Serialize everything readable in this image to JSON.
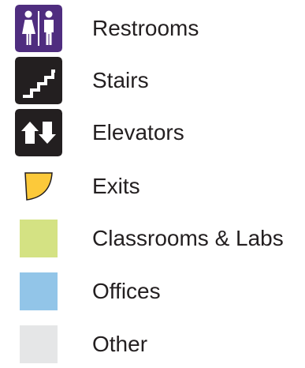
{
  "legend": {
    "items": [
      {
        "id": "restrooms",
        "label": "Restrooms",
        "icon": "restroom-icon",
        "color": "#4f2d7f"
      },
      {
        "id": "stairs",
        "label": "Stairs",
        "icon": "stairs-icon",
        "color": "#231f20"
      },
      {
        "id": "elevators",
        "label": "Elevators",
        "icon": "elevator-icon",
        "color": "#231f20"
      },
      {
        "id": "exits",
        "label": "Exits",
        "icon": "exit-icon",
        "color": "#fcc93a"
      },
      {
        "id": "classrooms",
        "label": "Classrooms & Labs",
        "icon": "swatch",
        "color": "#d4e283"
      },
      {
        "id": "offices",
        "label": "Offices",
        "icon": "swatch",
        "color": "#92c5e8"
      },
      {
        "id": "other",
        "label": "Other",
        "icon": "swatch",
        "color": "#e5e6e7"
      }
    ]
  }
}
